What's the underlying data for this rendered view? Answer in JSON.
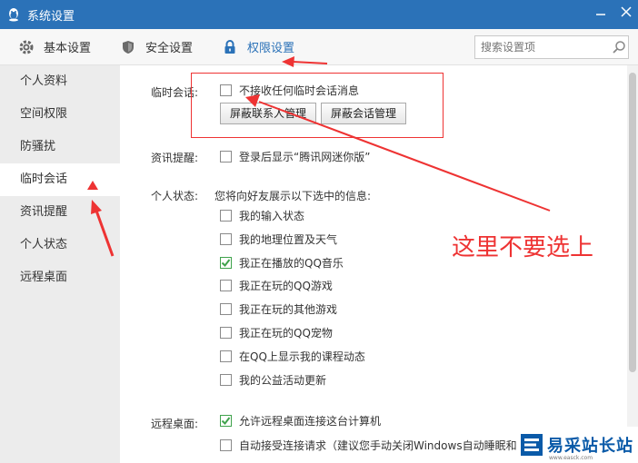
{
  "window": {
    "title": "系统设置",
    "controls": [
      "minimize",
      "close"
    ]
  },
  "toolbar": {
    "tabs": [
      {
        "label": "基本设置",
        "icon": "gear-icon"
      },
      {
        "label": "安全设置",
        "icon": "shield-icon"
      },
      {
        "label": "权限设置",
        "icon": "lock-icon"
      }
    ],
    "active_tab": "权限设置",
    "search_placeholder": "搜索设置项"
  },
  "sidebar": {
    "items": [
      {
        "label": "个人资料"
      },
      {
        "label": "空间权限"
      },
      {
        "label": "防骚扰"
      },
      {
        "label": "临时会话"
      },
      {
        "label": "资讯提醒"
      },
      {
        "label": "个人状态"
      },
      {
        "label": "远程桌面"
      }
    ],
    "active_item": "临时会话"
  },
  "temp_session": {
    "label": "临时会话:",
    "option": {
      "label": "不接收任何临时会话消息",
      "checked": false
    },
    "buttons": [
      "屏蔽联系人管理",
      "屏蔽会话管理"
    ]
  },
  "news": {
    "label": "资讯提醒:",
    "option": {
      "label": "登录后显示“腾讯网迷你版”",
      "checked": false
    }
  },
  "status": {
    "label": "个人状态:",
    "description": "您将向好友展示以下选中的信息:",
    "options": [
      {
        "label": "我的输入状态",
        "checked": false
      },
      {
        "label": "我的地理位置及天气",
        "checked": false
      },
      {
        "label": "我正在播放的QQ音乐",
        "checked": true
      },
      {
        "label": "我正在玩的QQ游戏",
        "checked": false
      },
      {
        "label": "我正在玩的其他游戏",
        "checked": false
      },
      {
        "label": "我正在玩的QQ宠物",
        "checked": false
      },
      {
        "label": "在QQ上显示我的课程动态",
        "checked": false
      },
      {
        "label": "我的公益活动更新",
        "checked": false
      }
    ]
  },
  "remote": {
    "label": "远程桌面:",
    "options": [
      {
        "label": "允许远程桌面连接这台计算机",
        "checked": true
      },
      {
        "label": "自动接受连接请求（建议您手动关闭Windows自动睡眠和",
        "checked": false
      }
    ]
  },
  "annotation": {
    "text": "这里不要选上",
    "color": "#ee3333"
  },
  "watermark": {
    "text": "易采站长站",
    "sub": "www.easck.com"
  },
  "colors": {
    "titlebar": "#2b72b8",
    "accent": "#2b72b8",
    "check": "#3fa24c",
    "annotation": "#ee3333"
  }
}
